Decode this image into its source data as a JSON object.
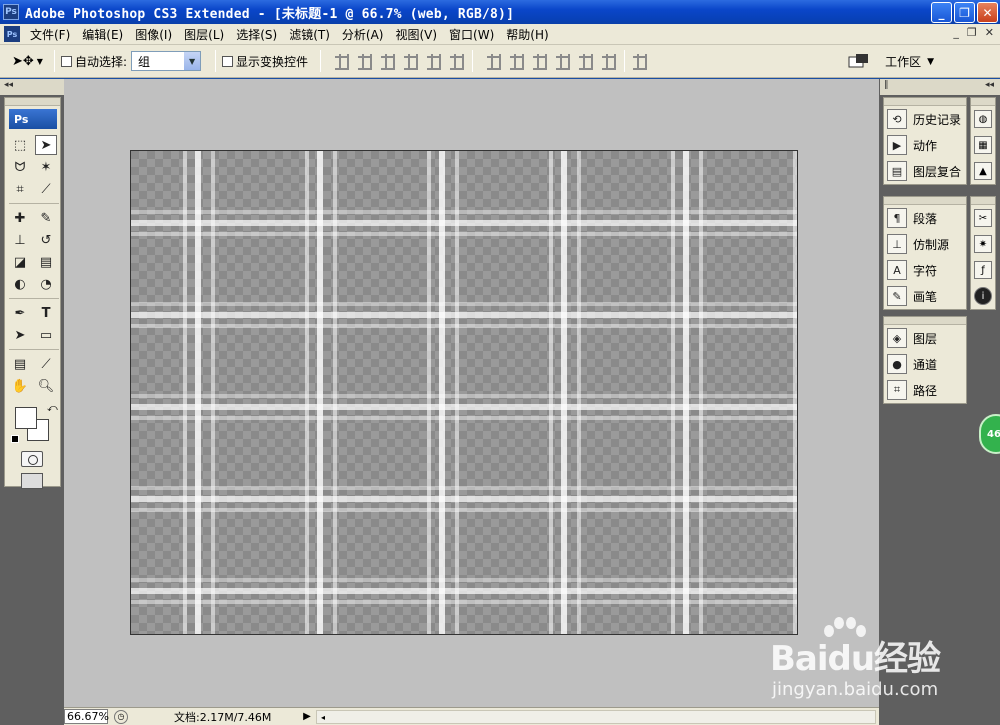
{
  "window": {
    "app_badge": "Ps",
    "title": "Adobe Photoshop CS3 Extended - [未标题-1 @ 66.7% (web, RGB/8)]",
    "buttons": [
      "_",
      "❐",
      "✕"
    ]
  },
  "menubar": {
    "items": [
      "文件(F)",
      "编辑(E)",
      "图像(I)",
      "图层(L)",
      "选择(S)",
      "滤镜(T)",
      "分析(A)",
      "视图(V)",
      "窗口(W)",
      "帮助(H)"
    ],
    "doc_controls": [
      "_",
      "❐",
      "✕"
    ]
  },
  "options": {
    "auto_select_label": "自动选择:",
    "auto_select_value": "组",
    "show_transform_label": "显示变换控件",
    "workspace_label": "工作区"
  },
  "toolbox": {
    "logo": "Ps"
  },
  "panels": {
    "group1": [
      "历史记录",
      "动作",
      "图层复合"
    ],
    "group2": [
      "段落",
      "仿制源",
      "字符",
      "画笔"
    ],
    "group3": [
      "图层",
      "通道",
      "路径"
    ]
  },
  "status": {
    "zoom": "66.67%",
    "doc_info": "文档:2.17M/7.46M"
  },
  "floater": {
    "text": "46"
  },
  "watermark": {
    "brand": "Baidu经验",
    "url": "jingyan.baidu.com"
  },
  "colors": {
    "titlebar": "#0a46c9",
    "chrome": "#ece9d8",
    "workspace_bg": "#c0c0c0",
    "dark_bg": "#5f5f5f"
  }
}
